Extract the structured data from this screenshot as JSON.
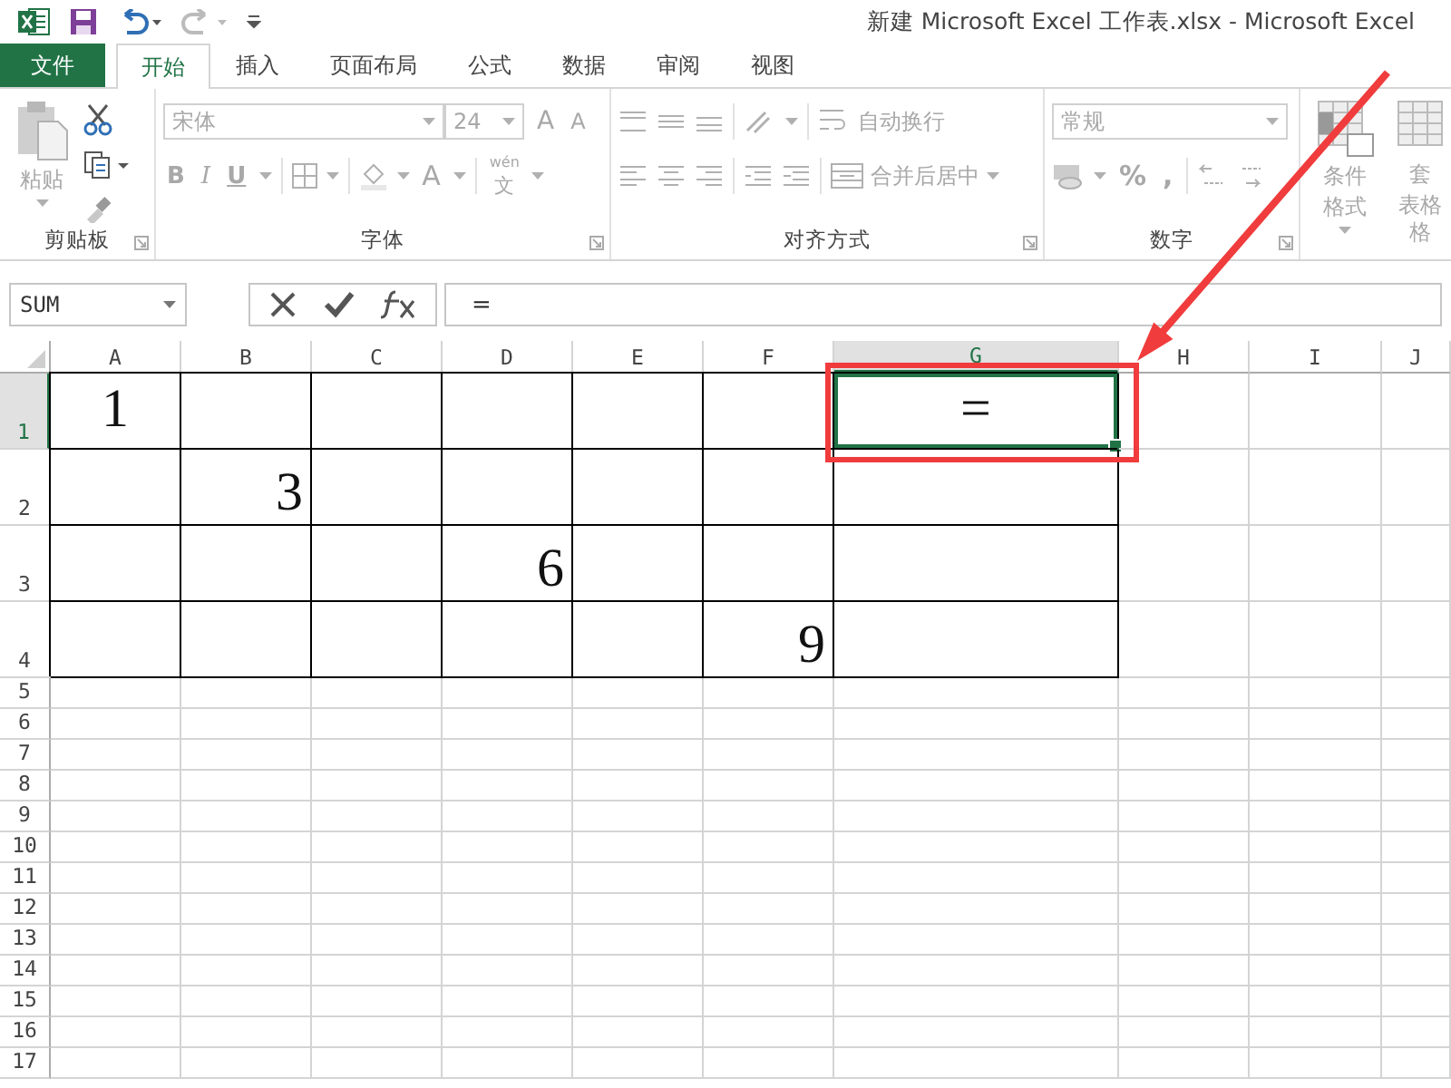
{
  "title_bar": {
    "title": "新建 Microsoft Excel 工作表.xlsx - Microsoft Excel",
    "undo_enabled": true,
    "redo_enabled": false
  },
  "menu_tabs": [
    {
      "label": "文件",
      "kind": "file",
      "selected": false
    },
    {
      "label": "开始",
      "kind": "tab",
      "selected": true
    },
    {
      "label": "插入",
      "kind": "tab",
      "selected": false
    },
    {
      "label": "页面布局",
      "kind": "tab",
      "selected": false
    },
    {
      "label": "公式",
      "kind": "tab",
      "selected": false
    },
    {
      "label": "数据",
      "kind": "tab",
      "selected": false
    },
    {
      "label": "审阅",
      "kind": "tab",
      "selected": false
    },
    {
      "label": "视图",
      "kind": "tab",
      "selected": false
    }
  ],
  "ribbon": {
    "disabled": true,
    "groups": [
      {
        "kind": "clipboard",
        "label": "剪贴板",
        "paste_label": "粘贴"
      },
      {
        "kind": "font",
        "label": "字体",
        "font_name": "宋体",
        "font_size": "24",
        "grow_glyph": "A",
        "shrink_glyph": "A",
        "style_buttons": [
          "B",
          "I",
          "U"
        ],
        "color_glyph": "A",
        "phonetic_top": "wén",
        "phonetic_bottom": "文"
      },
      {
        "kind": "alignment",
        "label": "对齐方式",
        "wrap_label": "自动换行",
        "merge_label": "合并后居中"
      },
      {
        "kind": "number",
        "label": "数字",
        "format": "常规",
        "percent": "%",
        "comma": ","
      },
      {
        "kind": "styles",
        "conditional_label": "条件格式",
        "table_label_lines": [
          "套",
          "表格格"
        ]
      }
    ]
  },
  "formula_bar": {
    "name_box": "SUM",
    "formula": "="
  },
  "sheet": {
    "columns": [
      {
        "label": "A",
        "selected": false
      },
      {
        "label": "B",
        "selected": false
      },
      {
        "label": "C",
        "selected": false
      },
      {
        "label": "D",
        "selected": false
      },
      {
        "label": "E",
        "selected": false
      },
      {
        "label": "F",
        "selected": false
      },
      {
        "label": "G",
        "selected": true
      },
      {
        "label": "H",
        "selected": false
      },
      {
        "label": "I",
        "selected": false
      },
      {
        "label": "J",
        "selected": false
      }
    ],
    "rows": [
      {
        "label": "1",
        "selected": true,
        "kind": "tall",
        "cells": [
          {
            "text": "1",
            "centered": true
          },
          {},
          {},
          {},
          {},
          {},
          {
            "text": "=",
            "centered": true,
            "selected": true
          }
        ]
      },
      {
        "label": "2",
        "selected": false,
        "kind": "tall",
        "cells": [
          {},
          {
            "text": "3",
            "centered": false
          },
          {},
          {},
          {},
          {},
          {}
        ]
      },
      {
        "label": "3",
        "selected": false,
        "kind": "tall",
        "cells": [
          {},
          {},
          {},
          {
            "text": "6",
            "centered": false
          },
          {},
          {},
          {}
        ]
      },
      {
        "label": "4",
        "selected": false,
        "kind": "tall",
        "cells": [
          {},
          {},
          {},
          {},
          {},
          {
            "text": "9",
            "centered": false
          },
          {}
        ]
      },
      {
        "label": "5",
        "selected": false,
        "kind": "normal"
      },
      {
        "label": "6",
        "selected": false,
        "kind": "normal"
      },
      {
        "label": "7",
        "selected": false,
        "kind": "normal"
      },
      {
        "label": "8",
        "selected": false,
        "kind": "normal"
      },
      {
        "label": "9",
        "selected": false,
        "kind": "normal"
      },
      {
        "label": "10",
        "selected": false,
        "kind": "normal"
      },
      {
        "label": "11",
        "selected": false,
        "kind": "normal"
      },
      {
        "label": "12",
        "selected": false,
        "kind": "normal"
      },
      {
        "label": "13",
        "selected": false,
        "kind": "normal"
      },
      {
        "label": "14",
        "selected": false,
        "kind": "normal"
      },
      {
        "label": "15",
        "selected": false,
        "kind": "normal"
      },
      {
        "label": "16",
        "selected": false,
        "kind": "normal"
      },
      {
        "label": "17",
        "selected": false,
        "kind": "normal"
      }
    ]
  }
}
